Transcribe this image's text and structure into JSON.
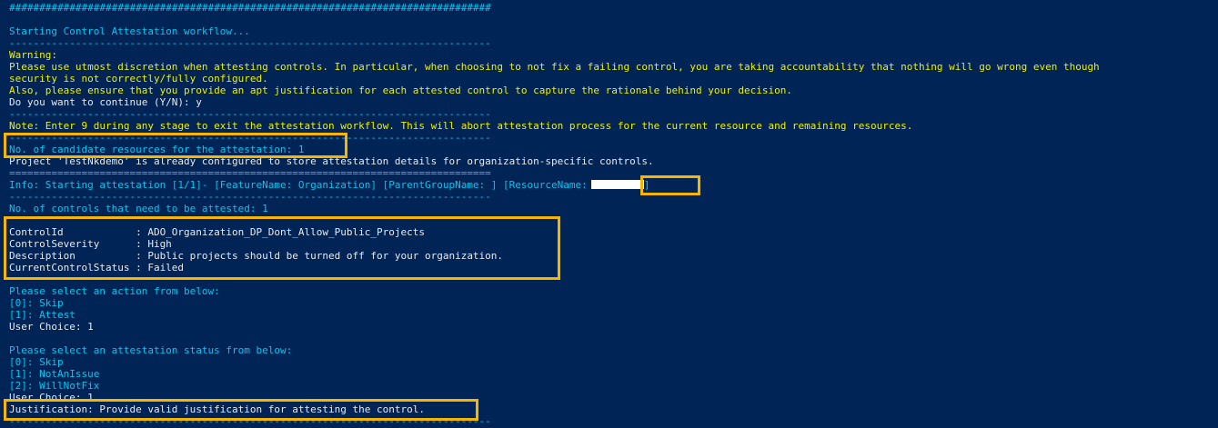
{
  "terminal": {
    "lines": [
      {
        "text": "################################################################################",
        "cls": "c"
      },
      {
        "text": "",
        "cls": "c"
      },
      {
        "text": "Starting Control Attestation workflow...",
        "cls": "c"
      },
      {
        "text": "--------------------------------------------------------------------------------",
        "cls": "c"
      },
      {
        "text": "Warning:",
        "cls": "y"
      },
      {
        "text": "Please use utmost discretion when attesting controls. In particular, when choosing to not fix a failing control, you are taking accountability that nothing will go wrong even though",
        "cls": "y"
      },
      {
        "text": "security is not correctly/fully configured.",
        "cls": "y"
      },
      {
        "text": "Also, please ensure that you provide an apt justification for each attested control to capture the rationale behind your decision.",
        "cls": "y"
      },
      {
        "text": "Do you want to continue (Y/N): y",
        "cls": "w"
      },
      {
        "text": "--------------------------------------------------------------------------------",
        "cls": "c"
      },
      {
        "text": "Note: Enter 9 during any stage to exit the attestation workflow. This will abort attestation process for the current resource and remaining resources.",
        "cls": "y"
      },
      {
        "text": "--------------------------------------------------------------------------------",
        "cls": "c"
      },
      {
        "text": "No. of candidate resources for the attestation: 1",
        "cls": "c"
      },
      {
        "text": "Project 'TestNkdemo' is already configured to store attestation details for organization-specific controls.",
        "cls": "w"
      },
      {
        "text": "================================================================================",
        "cls": "c"
      },
      {
        "text": "Info: Starting attestation [1/1]- [FeatureName: Organization] [ParentGroupName: ] [ResourceName:",
        "cls": "c",
        "redact": true
      },
      {
        "text": "--------------------------------------------------------------------------------",
        "cls": "c"
      },
      {
        "text": "No. of controls that need to be attested: 1",
        "cls": "c"
      },
      {
        "text": "",
        "cls": "c"
      },
      {
        "text": "ControlId            : ADO_Organization_DP_Dont_Allow_Public_Projects",
        "cls": "w"
      },
      {
        "text": "ControlSeverity      : High",
        "cls": "w"
      },
      {
        "text": "Description          : Public projects should be turned off for your organization.",
        "cls": "w"
      },
      {
        "text": "CurrentControlStatus : Failed",
        "cls": "w"
      },
      {
        "text": "",
        "cls": "c"
      },
      {
        "text": "Please select an action from below:",
        "cls": "c"
      },
      {
        "text": "[0]: Skip",
        "cls": "c"
      },
      {
        "text": "[1]: Attest",
        "cls": "c"
      },
      {
        "text": "User Choice: 1",
        "cls": "w"
      },
      {
        "text": "",
        "cls": "c"
      },
      {
        "text": "Please select an attestation status from below:",
        "cls": "c"
      },
      {
        "text": "[0]: Skip",
        "cls": "c"
      },
      {
        "text": "[1]: NotAnIssue",
        "cls": "c"
      },
      {
        "text": "[2]: WillNotFix",
        "cls": "c"
      },
      {
        "text": "User Choice: 1",
        "cls": "w"
      },
      {
        "text": "Justification: Provide valid justification for attesting the control.",
        "cls": "w"
      },
      {
        "text": "--------------------------------------------------------------------------------",
        "cls": "c"
      }
    ],
    "redacted_suffix": "]"
  }
}
